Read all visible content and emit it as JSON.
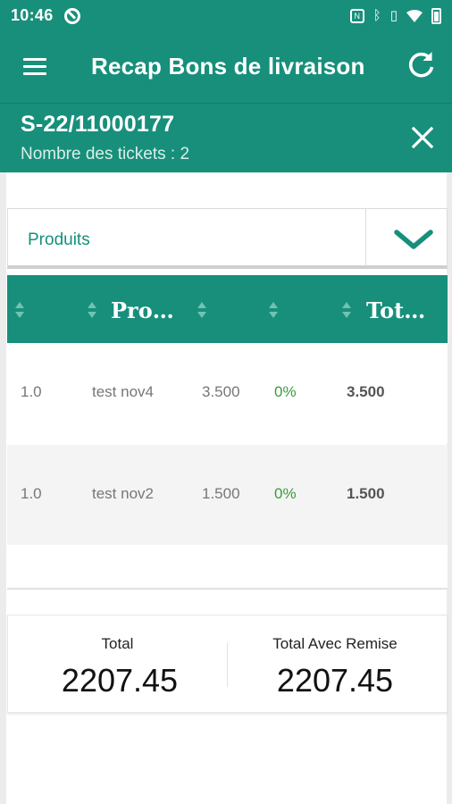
{
  "status_bar": {
    "time": "10:46",
    "icons": [
      "sync-icon",
      "nfc-icon",
      "bluetooth-icon",
      "vibrate-icon",
      "wifi-icon",
      "battery-icon"
    ]
  },
  "app_bar": {
    "title": "Recap Bons de livraison"
  },
  "document": {
    "number": "S-22/11000177",
    "tickets": "Nombre des tickets : 2"
  },
  "filter": {
    "selected": "Produits"
  },
  "table": {
    "headers": [
      "",
      "Pro…",
      "",
      "",
      "Tot…"
    ],
    "rows": [
      {
        "qty": "1.0",
        "product": "test nov4",
        "price": "3.500",
        "discount": "0%",
        "total": "3.500"
      },
      {
        "qty": "1.0",
        "product": "test nov2",
        "price": "1.500",
        "discount": "0%",
        "total": "1.500"
      }
    ]
  },
  "totals": {
    "total_label": "Total",
    "total_value": "2207.45",
    "total_discount_label": "Total Avec Remise",
    "total_discount_value": "2207.45"
  },
  "colors": {
    "primary": "#178f7b",
    "discount_green": "#3a9c3a"
  }
}
